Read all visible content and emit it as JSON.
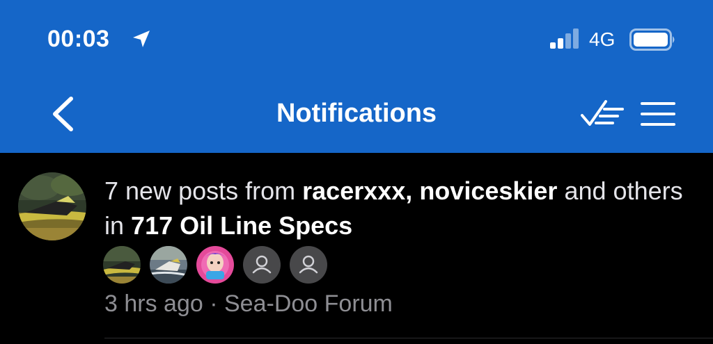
{
  "status_bar": {
    "time": "00:03",
    "network": "4G",
    "icons": [
      "location-arrow-icon",
      "cellular-signal-icon",
      "battery-icon"
    ]
  },
  "nav": {
    "title": "Notifications",
    "icons": [
      "back-chevron-icon",
      "mark-all-read-icon",
      "hamburger-menu-icon"
    ]
  },
  "notification": {
    "count_text": "7 new posts from",
    "user1": "racerxxx,",
    "user2": "noviceskier",
    "and_text": "and",
    "others_text": "others in",
    "thread": "717 Oil Line Specs",
    "time_ago": "3 hrs ago",
    "separator": "·",
    "forum": "Sea-Doo Forum",
    "avatars": [
      "jetski-photo",
      "jetski-photo",
      "cartoon-photo",
      "default-user-icon",
      "default-user-icon"
    ]
  },
  "colors": {
    "header_bg": "#1566c8",
    "body_bg": "#000000",
    "primary_text": "#ffffff",
    "secondary_text": "#8e8e93",
    "placeholder_avatar": "#48484a"
  }
}
